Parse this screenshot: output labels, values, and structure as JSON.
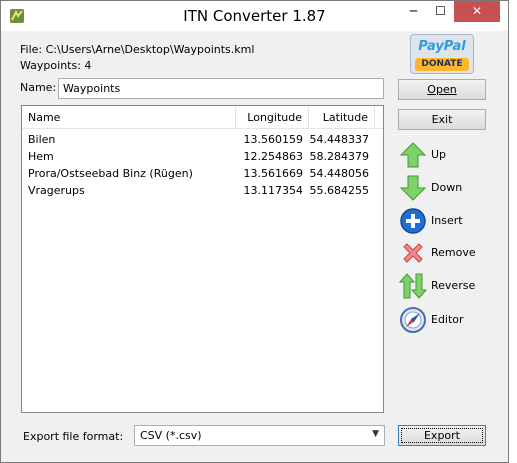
{
  "window": {
    "title": "ITN Converter 1.87",
    "controls": {
      "minimize": "─",
      "maximize": "☐",
      "close": "✕"
    }
  },
  "info": {
    "file": "File: C:\\Users\\Arne\\Desktop\\Waypoints.kml",
    "waypoints": "Waypoints: 4"
  },
  "name_field": {
    "label": "Name:",
    "value": "Waypoints"
  },
  "list": {
    "columns": [
      "Name",
      "Longitude",
      "Latitude"
    ],
    "rows": [
      [
        "Bilen",
        "13.560159",
        "54.448337"
      ],
      [
        "Hem",
        "12.254863",
        "58.284379"
      ],
      [
        "Prora/Ostseebad Binz (Rügen)",
        "13.561669",
        "54.448056"
      ],
      [
        "Vragerups",
        "13.117354",
        "55.684255"
      ]
    ]
  },
  "paypal": {
    "brand_a": "Pay",
    "brand_b": "Pal",
    "donate": "DONATE"
  },
  "buttons": {
    "open": "Open",
    "exit": "Exit",
    "export": "Export"
  },
  "actions": {
    "up": {
      "label": "Up",
      "icon": "arrow-up-icon"
    },
    "down": {
      "label": "Down",
      "icon": "arrow-down-icon"
    },
    "insert": {
      "label": "Insert",
      "icon": "plus-circle-icon"
    },
    "remove": {
      "label": "Remove",
      "icon": "x-icon"
    },
    "reverse": {
      "label": "Reverse",
      "icon": "reverse-arrows-icon"
    },
    "editor": {
      "label": "Editor",
      "icon": "compass-icon"
    }
  },
  "export": {
    "label": "Export file format:",
    "selected": "CSV (*.csv)"
  },
  "colors": {
    "close_button": "#c75050",
    "green_arrow": "#4caf3a",
    "insert_blue": "#1f6fd1",
    "remove_red": "#e06060"
  }
}
